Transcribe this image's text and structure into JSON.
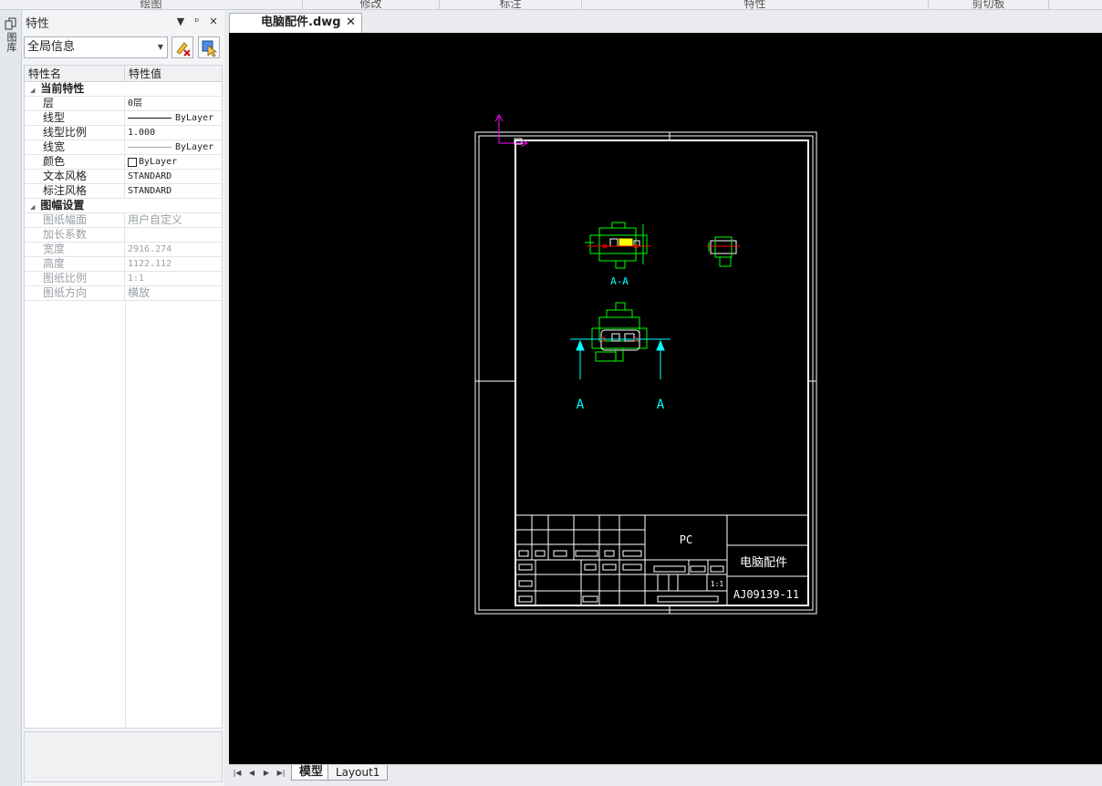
{
  "ribbon": {
    "groups": [
      "绘图",
      "修改",
      "标注",
      "特性",
      "剪切板"
    ]
  },
  "side_tab": {
    "label": "图库"
  },
  "panel": {
    "title": "特性",
    "header_buttons": [
      "▼",
      "ᵖ",
      "✕"
    ],
    "selector": {
      "value": "全局信息"
    },
    "columns": [
      "特性名",
      "特性值"
    ],
    "categories": [
      {
        "name": "当前特性",
        "rows": [
          {
            "key": "层",
            "value": "0层"
          },
          {
            "key": "线型",
            "value": "ByLayer",
            "style": "line"
          },
          {
            "key": "线型比例",
            "value": "1.000"
          },
          {
            "key": "线宽",
            "value": "ByLayer",
            "style": "thin-line"
          },
          {
            "key": "颜色",
            "value": "ByLayer",
            "style": "color"
          },
          {
            "key": "文本风格",
            "value": "STANDARD"
          },
          {
            "key": "标注风格",
            "value": "STANDARD"
          }
        ]
      },
      {
        "name": "图幅设置",
        "rows": [
          {
            "key": "图纸幅面",
            "value": "用户自定义"
          },
          {
            "key": "加长系数",
            "value": ""
          },
          {
            "key": "宽度",
            "value": "2916.274"
          },
          {
            "key": "高度",
            "value": "1122.112"
          },
          {
            "key": "图纸比例",
            "value": "1:1"
          },
          {
            "key": "图纸方向",
            "value": "横放"
          }
        ]
      }
    ]
  },
  "document": {
    "tab_title": "电脑配件.dwg",
    "close_glyph": "✕",
    "drawing": {
      "section_label": "A-A",
      "arrow_left": "A",
      "arrow_right": "A",
      "title_block": {
        "material": "PC",
        "part_name": "电脑配件",
        "drawing_no": "AJ09139-11",
        "scale": "1:1"
      }
    }
  },
  "layout_tabs": {
    "nav": [
      "|◀",
      "◀",
      "▶",
      "▶|"
    ],
    "tabs": [
      "模型",
      "Layout1"
    ],
    "active": "模型"
  },
  "colors": {
    "canvas": "#000000",
    "frame": "#ffffff",
    "geometry": "#00ff00",
    "center": "#ff0000",
    "dimension": "#00ffff",
    "ucs": "#ff00ff",
    "highlight": "#ffff00"
  }
}
